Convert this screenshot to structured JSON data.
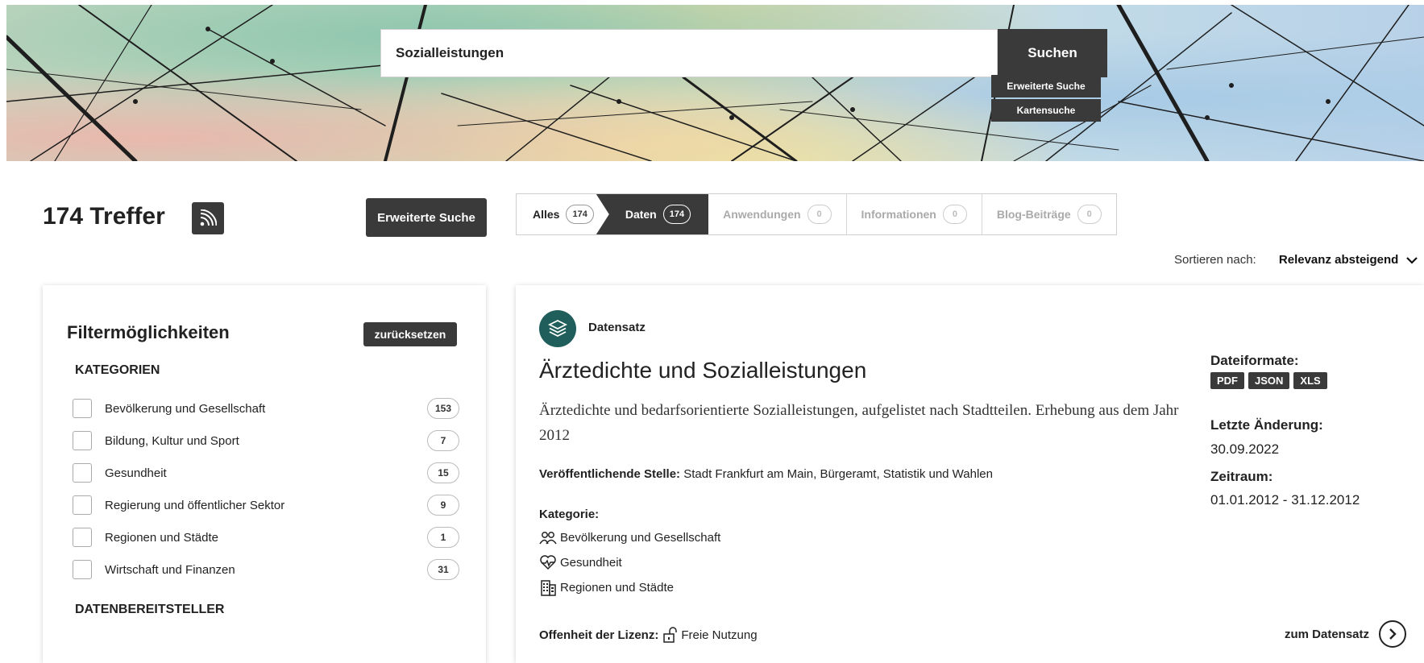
{
  "hero": {
    "search": {
      "value": "Sozialleistungen",
      "placeholder": ""
    },
    "search_button": "Suchen",
    "advanced_search": "Erweiterte Suche",
    "map_search": "Kartensuche"
  },
  "results": {
    "hits_label": "174 Treffer",
    "advanced_search_button": "Erweiterte Suche",
    "tabs": [
      {
        "label": "Alles",
        "count": "174"
      },
      {
        "label": "Daten",
        "count": "174"
      },
      {
        "label": "Anwendungen",
        "count": "0"
      },
      {
        "label": "Informationen",
        "count": "0"
      },
      {
        "label": "Blog-Beiträge",
        "count": "0"
      }
    ],
    "sort_label": "Sortieren nach:",
    "sort_value": "Relevanz absteigend"
  },
  "filters": {
    "title": "Filtermöglichkeiten",
    "reset": "zurücksetzen",
    "categories_heading": "KATEGORIEN",
    "categories": [
      {
        "label": "Bevölkerung und Gesellschaft",
        "count": "153"
      },
      {
        "label": "Bildung, Kultur und Sport",
        "count": "7"
      },
      {
        "label": "Gesundheit",
        "count": "15"
      },
      {
        "label": "Regierung und öffentlicher Sektor",
        "count": "9"
      },
      {
        "label": "Regionen und Städte",
        "count": "1"
      },
      {
        "label": "Wirtschaft und Finanzen",
        "count": "31"
      }
    ],
    "providers_heading": "DATENBEREITSTELLER"
  },
  "dataset": {
    "type": "Datensatz",
    "title": "Ärztedichte und Sozialleistungen",
    "description": "Ärztedichte und bedarfsorientierte Sozialleistungen, aufgelistet nach Stadtteilen. Erhebung aus dem Jahr 2012",
    "publisher_label": "Veröffentlichende Stelle:",
    "publisher_value": "Stadt Frankfurt am Main, Bürgeramt, Statistik und Wahlen",
    "category_label": "Kategorie:",
    "categories": [
      {
        "label": "Bevölkerung und Gesellschaft",
        "icon": "people-icon"
      },
      {
        "label": "Gesundheit",
        "icon": "heart-pulse-icon"
      },
      {
        "label": "Regionen und Städte",
        "icon": "building-icon"
      }
    ],
    "license_label": "Offenheit der Lizenz:",
    "license_value": "Freie Nutzung",
    "formats_label": "Dateiformate:",
    "formats": [
      "PDF",
      "JSON",
      "XLS"
    ],
    "modified_label": "Letzte Änderung:",
    "modified_value": "30.09.2022",
    "period_label": "Zeitraum:",
    "period_value": "01.01.2012 - 31.12.2012",
    "link_label": "zum Datensatz"
  }
}
